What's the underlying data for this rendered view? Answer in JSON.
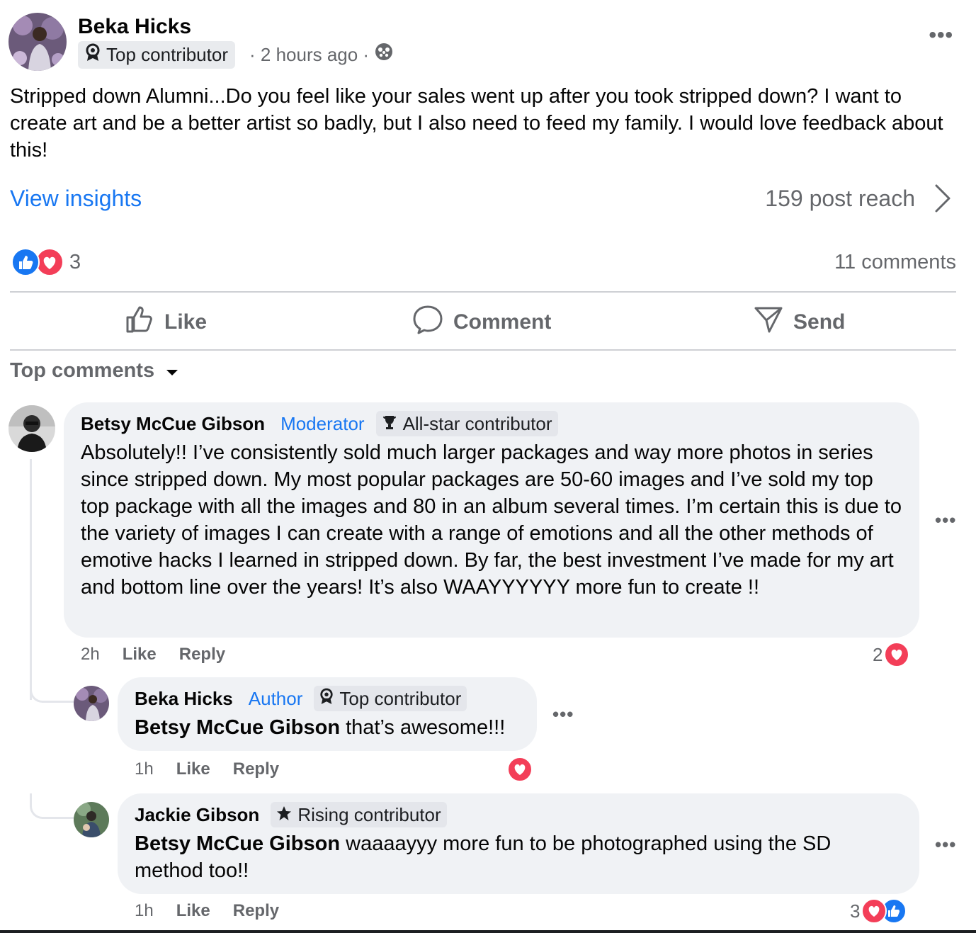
{
  "post": {
    "author": "Beka Hicks",
    "badge": "Top contributor",
    "time": "· 2 hours ago ·",
    "text": "Stripped down Alumni...Do you feel like your sales went up after you took stripped down? I want to create art and be a better artist so badly, but I also need to feed my family. I would love feedback about this!",
    "insights_label": "View insights",
    "reach": "159 post reach",
    "reaction_count": "3",
    "comments_count": "11 comments"
  },
  "actions": {
    "like": "Like",
    "comment": "Comment",
    "send": "Send"
  },
  "sort_label": "Top comments",
  "comments": [
    {
      "name": "Betsy McCue Gibson",
      "role": "Moderator",
      "badge": "All-star contributor",
      "text": "Absolutely!! I’ve consistently sold much larger packages and way more photos in series since stripped down. My most popular packages are 50-60 images and I’ve sold my top top package with all the images and 80 in an album several times. I’m certain this is due to the variety of images I can create with a range of emotions and all the other methods of emotive hacks I learned in stripped down. By far, the best investment I’ve made for my art and bottom line over the years! It’s also WAAYYYYYY more fun to create !!",
      "time": "2h",
      "like": "Like",
      "reply": "Reply",
      "reactions": "2"
    },
    {
      "name": "Beka Hicks",
      "role": "Author",
      "badge": "Top contributor",
      "mention": "Betsy McCue Gibson",
      "text": " that’s awesome!!!",
      "time": "1h",
      "like": "Like",
      "reply": "Reply"
    },
    {
      "name": "Jackie Gibson",
      "badge": "Rising contributor",
      "mention": "Betsy McCue Gibson",
      "text": " waaaayyy more fun to be photographed using the SD method too!!",
      "time": "1h",
      "like": "Like",
      "reply": "Reply",
      "reactions": "3"
    }
  ],
  "colors": {
    "accent": "#1877f2",
    "love": "#f33e58",
    "muted": "#65676b",
    "bubble": "#f0f2f5"
  },
  "icons": [
    "contributor-badge-icon",
    "globe-icon",
    "more-icon",
    "chevron-right-icon",
    "like-reaction-icon",
    "love-reaction-icon",
    "thumbs-up-icon",
    "comment-icon",
    "send-icon",
    "caret-down-icon",
    "trophy-icon",
    "star-icon"
  ]
}
